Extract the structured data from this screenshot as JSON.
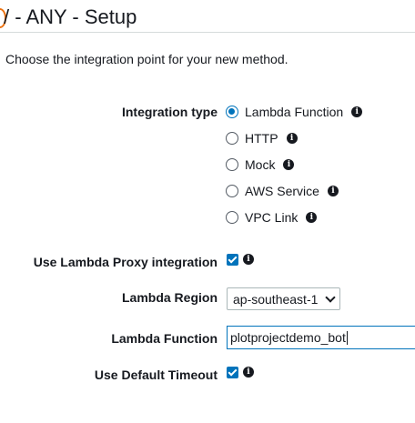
{
  "header": {
    "title": "/ - ANY - Setup"
  },
  "intro_text": "Choose the integration point for your new method.",
  "integration_type": {
    "label": "Integration type",
    "options": [
      {
        "label": "Lambda Function",
        "selected": true
      },
      {
        "label": "HTTP",
        "selected": false
      },
      {
        "label": "Mock",
        "selected": false
      },
      {
        "label": "AWS Service",
        "selected": false
      },
      {
        "label": "VPC Link",
        "selected": false
      }
    ]
  },
  "lambda_proxy": {
    "label": "Use Lambda Proxy integration",
    "checked": true
  },
  "lambda_region": {
    "label": "Lambda Region",
    "value": "ap-southeast-1"
  },
  "lambda_function": {
    "label": "Lambda Function",
    "value": "plotprojectdemo_bot"
  },
  "default_timeout": {
    "label": "Use Default Timeout",
    "checked": true
  },
  "icons": {
    "info": "i"
  },
  "colors": {
    "accent": "#0073bb",
    "brand_orange": "#ec7211",
    "text": "#16191f",
    "divider": "#d5dbdb"
  }
}
